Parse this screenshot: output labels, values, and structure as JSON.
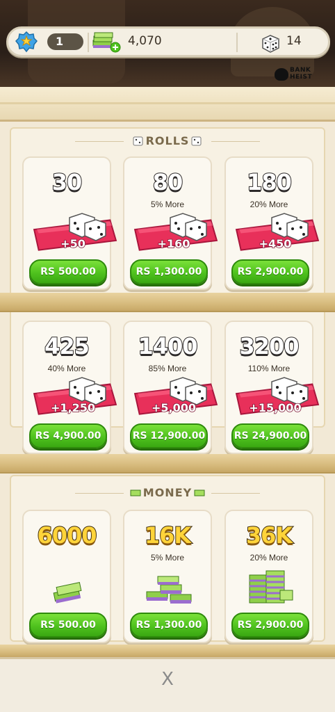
{
  "status": {
    "level": "1",
    "cash": "4,070",
    "dice": "14",
    "logo_text": "BANK HEIST"
  },
  "sections": {
    "rolls_label": "ROLLS",
    "money_label": "MONEY"
  },
  "rolls": [
    {
      "amount": "30",
      "bonus": "",
      "ribbon": "+50",
      "price": "RS 500.00"
    },
    {
      "amount": "80",
      "bonus": "5% More",
      "ribbon": "+160",
      "price": "RS 1,300.00"
    },
    {
      "amount": "180",
      "bonus": "20% More",
      "ribbon": "+450",
      "price": "RS 2,900.00"
    },
    {
      "amount": "425",
      "bonus": "40% More",
      "ribbon": "+1,250",
      "price": "RS 4,900.00"
    },
    {
      "amount": "1400",
      "bonus": "85% More",
      "ribbon": "+5,000",
      "price": "RS 12,900.00"
    },
    {
      "amount": "3200",
      "bonus": "110% More",
      "ribbon": "+15,000",
      "price": "RS 24,900.00"
    }
  ],
  "money": [
    {
      "amount": "6000",
      "bonus": "",
      "price": "RS 500.00"
    },
    {
      "amount": "16K",
      "bonus": "5% More",
      "price": "RS 1,300.00"
    },
    {
      "amount": "36K",
      "bonus": "20% More",
      "price": "RS 2,900.00"
    }
  ],
  "close_label": "X",
  "colors": {
    "price_green": "#4fc21e",
    "ribbon_red": "#e8305a",
    "cabinet": "#f2e9d6"
  }
}
